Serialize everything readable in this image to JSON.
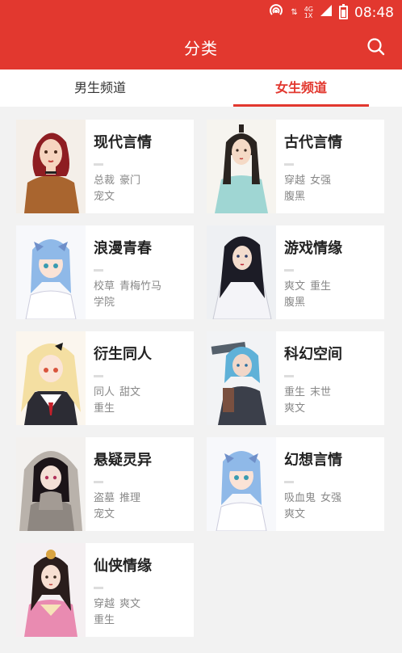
{
  "status": {
    "time": "08:48",
    "network": "4G",
    "network2": "1X"
  },
  "appbar": {
    "title": "分类"
  },
  "tabs": {
    "male": "男生频道",
    "female": "女生频道"
  },
  "categories": [
    {
      "name": "现代言情",
      "tags_line1": [
        "总裁",
        "豪门"
      ],
      "tags_line2": [
        "宠文"
      ]
    },
    {
      "name": "古代言情",
      "tags_line1": [
        "穿越",
        "女强"
      ],
      "tags_line2": [
        "腹黑"
      ]
    },
    {
      "name": "浪漫青春",
      "tags_line1": [
        "校草",
        "青梅竹马"
      ],
      "tags_line2": [
        "学院"
      ]
    },
    {
      "name": "游戏情缘",
      "tags_line1": [
        "爽文",
        "重生"
      ],
      "tags_line2": [
        "腹黑"
      ]
    },
    {
      "name": "衍生同人",
      "tags_line1": [
        "同人",
        "甜文"
      ],
      "tags_line2": [
        "重生"
      ]
    },
    {
      "name": "科幻空间",
      "tags_line1": [
        "重生",
        "末世"
      ],
      "tags_line2": [
        "爽文"
      ]
    },
    {
      "name": "悬疑灵异",
      "tags_line1": [
        "盗墓",
        "推理"
      ],
      "tags_line2": [
        "宠文"
      ]
    },
    {
      "name": "幻想言情",
      "tags_line1": [
        "吸血鬼",
        "女强"
      ],
      "tags_line2": [
        "爽文"
      ]
    },
    {
      "name": "仙侠情缘",
      "tags_line1": [
        "穿越",
        "爽文"
      ],
      "tags_line2": [
        "重生"
      ]
    }
  ],
  "colors": {
    "accent": "#e2382f",
    "background": "#f2f2f2"
  }
}
